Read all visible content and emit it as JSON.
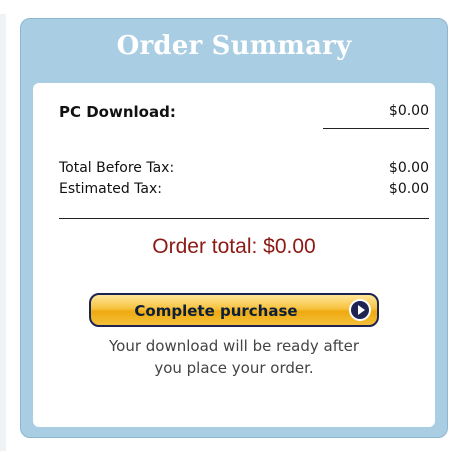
{
  "summary": {
    "title": "Order Summary",
    "download_label": "PC Download:",
    "download_value": "$0.00",
    "before_tax_label": "Total Before Tax:",
    "before_tax_value": "$0.00",
    "tax_label": "Estimated Tax:",
    "tax_value": "$0.00",
    "order_total": "Order total: $0.00",
    "purchase_button_label": "Complete purchase",
    "note_line1": "Your download will be ready after",
    "note_line2": "you place your order.",
    "colors": {
      "panel": "#a9cde2",
      "total_text": "#8b1a14",
      "button_gold": "#f7c23f",
      "button_border": "#1d2452"
    },
    "icons": {
      "arrow": "arrow-right-icon"
    }
  }
}
